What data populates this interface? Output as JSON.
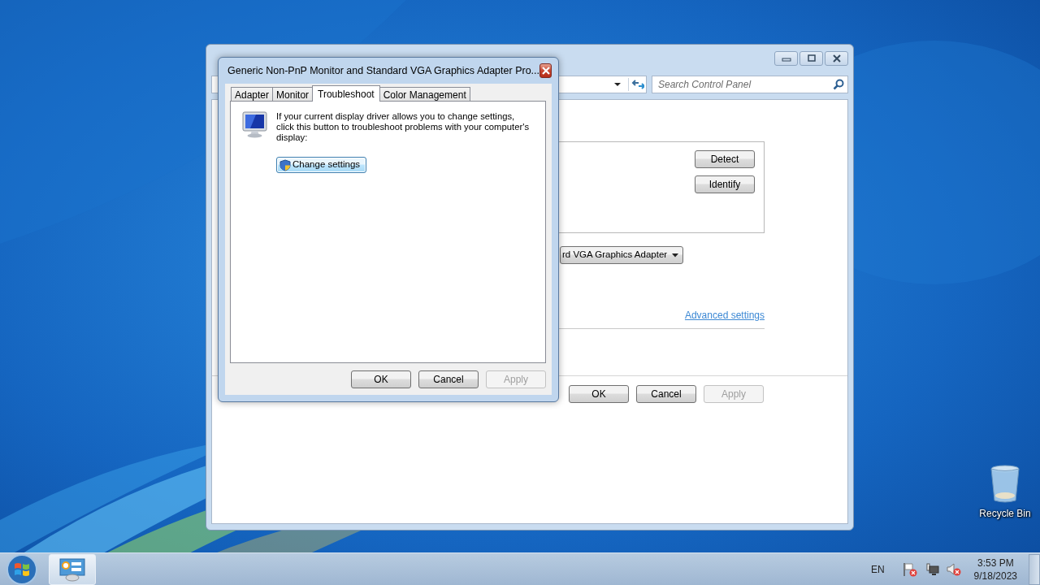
{
  "desktop": {
    "icons": [
      {
        "label": "Recycle Bin"
      }
    ]
  },
  "back_window": {
    "search": {
      "placeholder": "Search Control Panel"
    },
    "group_buttons": [
      {
        "label": "Detect",
        "disabled": false
      },
      {
        "label": "Identify",
        "disabled": false
      }
    ],
    "adapter_dropdown": {
      "value": "rd VGA Graphics Adapter"
    },
    "link": "Advanced settings",
    "buttons": [
      {
        "label": "OK",
        "disabled": false
      },
      {
        "label": "Cancel",
        "disabled": false
      },
      {
        "label": "Apply",
        "disabled": true
      }
    ]
  },
  "dialog": {
    "title": "Generic Non-PnP Monitor and Standard VGA Graphics Adapter Pro...",
    "tabs": [
      {
        "label": "Adapter",
        "selected": false
      },
      {
        "label": "Monitor",
        "selected": false
      },
      {
        "label": "Troubleshoot",
        "selected": true
      },
      {
        "label": "Color Management",
        "selected": false
      }
    ],
    "message": "If your current display driver allows you to change settings, click this button to troubleshoot problems with your computer's display:",
    "action_button": {
      "label": "Change settings",
      "focused": true
    },
    "buttons": [
      {
        "label": "OK",
        "disabled": false
      },
      {
        "label": "Cancel",
        "disabled": false
      },
      {
        "label": "Apply",
        "disabled": true
      }
    ]
  },
  "taskbar": {
    "language": "EN",
    "time": "3:53 PM",
    "date": "9/18/2023"
  }
}
